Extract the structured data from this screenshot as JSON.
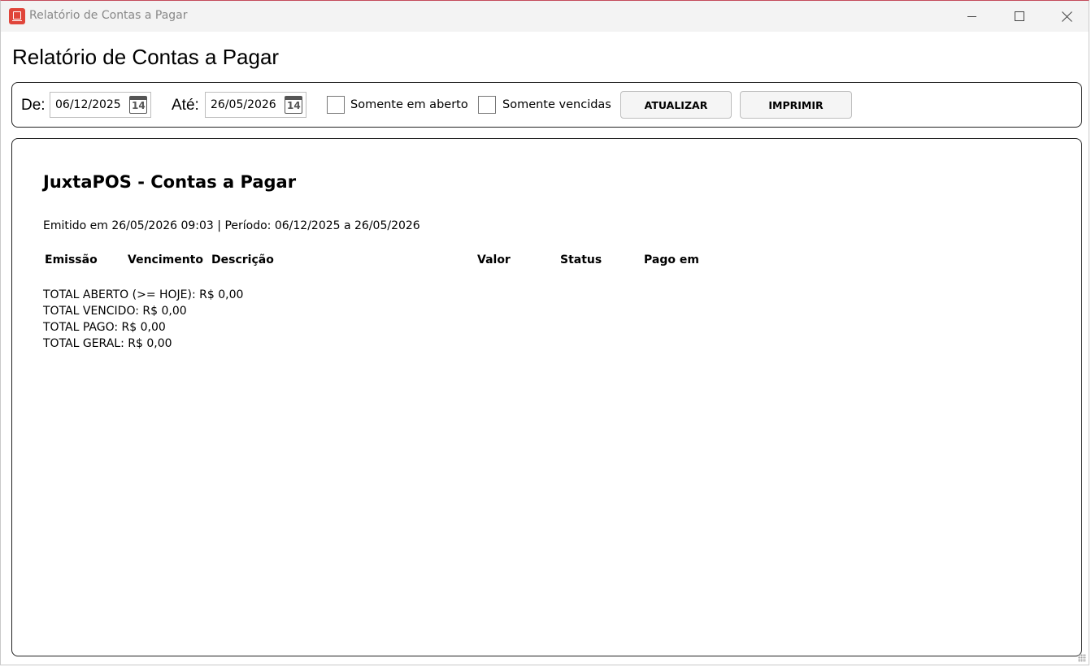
{
  "window": {
    "title": "Relatório de Contas a Pagar"
  },
  "page": {
    "title": "Relatório de Contas a Pagar"
  },
  "filters": {
    "de_label": "De:",
    "de_value": "06/12/2025",
    "ate_label": "Até:",
    "ate_value": "26/05/2026",
    "calendar_day": "14",
    "somente_aberto_label": "Somente em aberto",
    "somente_aberto_checked": false,
    "somente_vencidas_label": "Somente vencidas",
    "somente_vencidas_checked": false,
    "atualizar_label": "ATUALIZAR",
    "imprimir_label": "IMPRIMIR"
  },
  "report": {
    "title": "JuxtaPOS - Contas a Pagar",
    "emitido": "Emitido em 26/05/2026 09:03 | Período: 06/12/2025 a 26/05/2026",
    "columns": [
      "Emissão",
      "Vencimento",
      "Descrição",
      "Valor",
      "Status",
      "Pago em"
    ],
    "totals": [
      "TOTAL ABERTO (>= HOJE): R$ 0,00",
      "TOTAL VENCIDO: R$ 0,00",
      "TOTAL PAGO: R$ 0,00",
      "TOTAL GERAL: R$ 0,00"
    ]
  },
  "colors": {
    "accent": "#e0453a",
    "titlebar": "#f3f3f3"
  }
}
